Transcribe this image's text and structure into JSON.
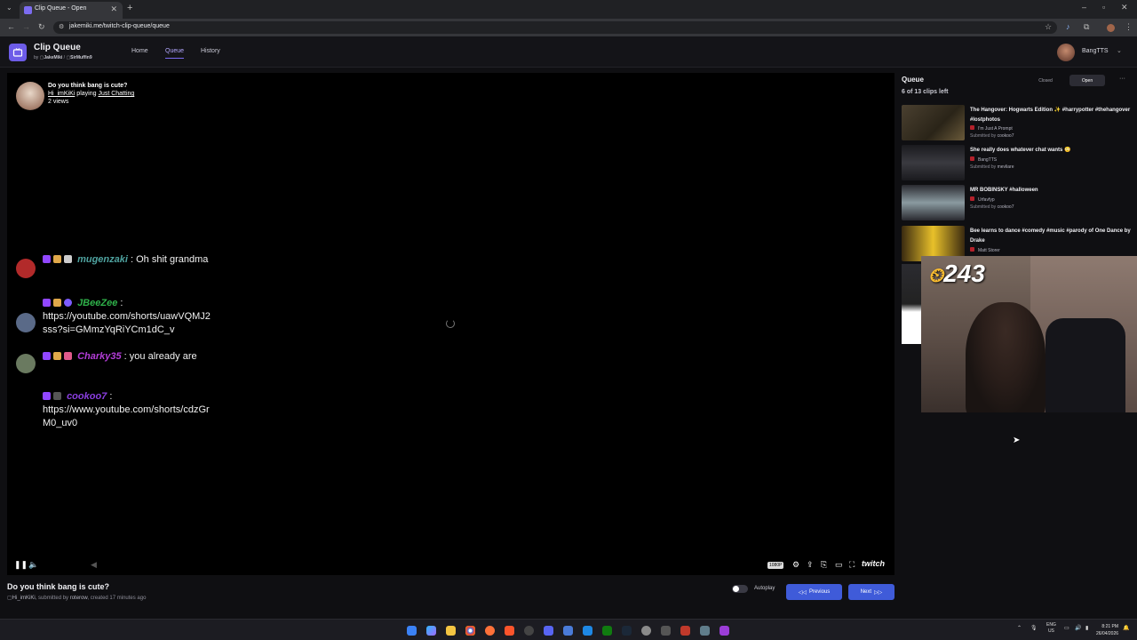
{
  "browser": {
    "tab_title": "Clip Queue - Open",
    "url": "jakemiki.me/twitch-clip-queue/queue"
  },
  "header": {
    "app_title": "Clip Queue",
    "by_label": "by",
    "author1": "JakeMiki",
    "separator": "/",
    "author2": "SirMuffin9",
    "nav": [
      "Home",
      "Queue",
      "History"
    ],
    "active_nav": "Queue",
    "username": "BangTTS"
  },
  "player": {
    "overlay_title": "Do you think bang is cute?",
    "overlay_channel": "Hi_imKiKi",
    "overlay_playing": "playing",
    "overlay_game": "Just Chatting",
    "overlay_views": "2 views",
    "quality": "1080P",
    "brand": "twitch",
    "chat": [
      {
        "user": "mugenzaki",
        "color": "#4fa3a0",
        "text": ": Oh shit grandma",
        "avatar_color": "#b22a2a"
      },
      {
        "user": "JBeeZee",
        "color": "#2fb24a",
        "text": ":",
        "text2": "https://youtube.com/shorts/uawVQMJ2sss?si=GMmzYqRiYCm1dC_v",
        "avatar_color": "#5a6a88"
      },
      {
        "user": "Charky35",
        "color": "#b43dd8",
        "text": ": you already are",
        "avatar_color": "#6a7a60"
      },
      {
        "user": "cookoo7",
        "color": "#8a3ee0",
        "text": ":",
        "text2": "https://www.youtube.com/shorts/cdzGrM0_uv0",
        "avatar_color": "#000000"
      }
    ]
  },
  "now_playing": {
    "title": "Do you think bang is cute?",
    "channel": "Hi_imKiKi",
    "submitted_label": ", submitted by",
    "submitter": "roterow",
    "created": ", created 17 minutes ago",
    "autoplay_label": "Autoplay",
    "autoplay_on": false,
    "previous_label": "Previous",
    "next_label": "Next"
  },
  "queue": {
    "heading": "Queue",
    "count_text": "6 of 13 clips left",
    "closed_label": "Closed",
    "open_label": "Open",
    "more_label": "···",
    "submitted_prefix": "Submitted by",
    "items": [
      {
        "title": "The Hangover: Hogwarts Edition ✨ #harrypotter #thehangover #lostphotos",
        "channel": "I'm Just A Prompt",
        "submitter": "cookoo7",
        "thumb": "#3a3226"
      },
      {
        "title": "She really does whatever chat wants 😳",
        "channel": "BangTTS",
        "submitter": "mevliare",
        "thumb": "#2a2a30"
      },
      {
        "title": "MR BOBINSKY #halloween",
        "channel": "Urfavfyp",
        "submitter": "cookoo7",
        "thumb": "#5a6a6e"
      },
      {
        "title": "Bee learns to dance #comedy #music #parody of One Dance by Drake",
        "channel": "Matt Storer",
        "submitter": "",
        "thumb": "#b8962a"
      }
    ]
  },
  "webcam": {
    "counter_prefix": "⏲",
    "counter": "243"
  },
  "taskbar": {
    "lang": "ENG",
    "region": "US",
    "time": "8:21 PM",
    "date": "26/04/2026"
  }
}
